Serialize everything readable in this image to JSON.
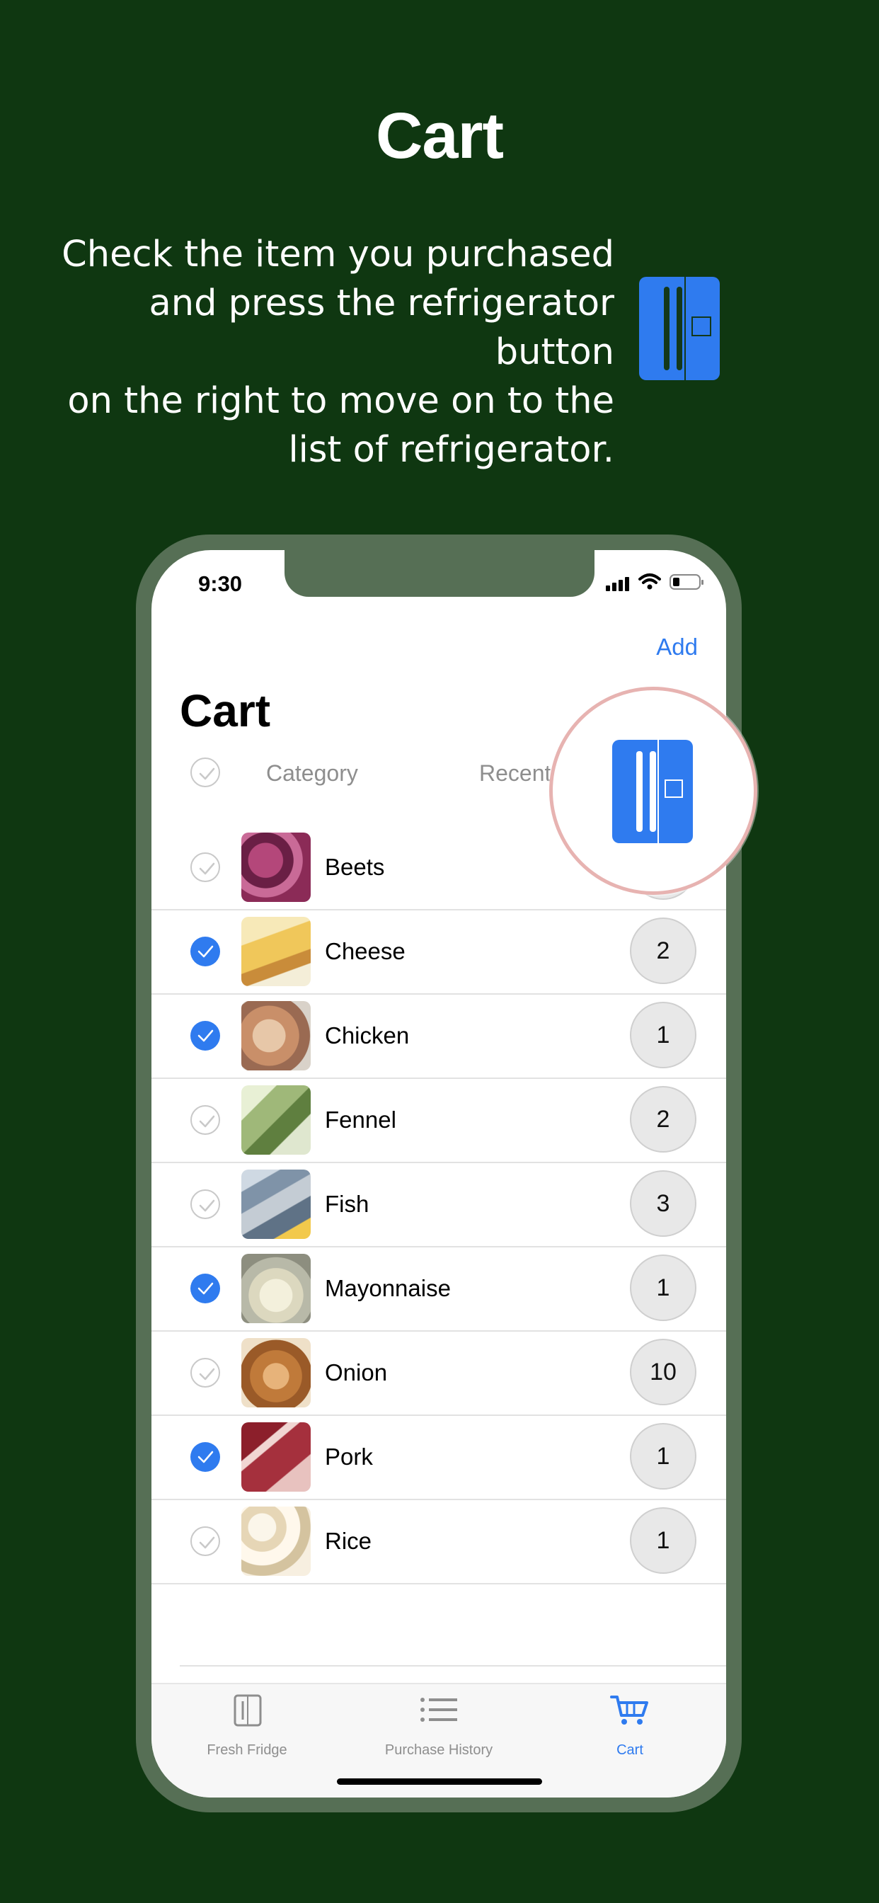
{
  "promo": {
    "headline": "Cart",
    "description_lines": [
      "Check the item you purchased",
      "and press the refrigerator button",
      "on the right to move on to the",
      "list of refrigerator."
    ],
    "button_icon": "refrigerator-icon"
  },
  "status_bar": {
    "time": "9:30",
    "icons": [
      "cellular-signal-icon",
      "wifi-icon",
      "battery-icon"
    ]
  },
  "nav": {
    "add_label": "Add",
    "title": "Cart"
  },
  "list_header": {
    "select_all_checked": false,
    "sort_options": [
      "Category",
      "Recent"
    ],
    "move_to_fridge_icon": "refrigerator-icon"
  },
  "items": [
    {
      "name": "Beets",
      "qty": "",
      "checked": false,
      "thumb": "beets"
    },
    {
      "name": "Cheese",
      "qty": "2",
      "checked": true,
      "thumb": "cheese"
    },
    {
      "name": "Chicken",
      "qty": "1",
      "checked": true,
      "thumb": "chicken"
    },
    {
      "name": "Fennel",
      "qty": "2",
      "checked": false,
      "thumb": "fennel"
    },
    {
      "name": "Fish",
      "qty": "3",
      "checked": false,
      "thumb": "fish"
    },
    {
      "name": "Mayonnaise",
      "qty": "1",
      "checked": true,
      "thumb": "mayonnaise"
    },
    {
      "name": "Onion",
      "qty": "10",
      "checked": false,
      "thumb": "onion"
    },
    {
      "name": "Pork",
      "qty": "1",
      "checked": true,
      "thumb": "pork"
    },
    {
      "name": "Rice",
      "qty": "1",
      "checked": false,
      "thumb": "rice"
    }
  ],
  "tabs": [
    {
      "label": "Fresh Fridge",
      "icon": "fridge-tab-icon",
      "active": false
    },
    {
      "label": "Purchase History",
      "icon": "list-icon",
      "active": false
    },
    {
      "label": "Cart",
      "icon": "cart-icon",
      "active": true
    }
  ],
  "colors": {
    "background": "#0f3711",
    "accent": "#2f7bef",
    "phone_frame": "#566f55"
  }
}
